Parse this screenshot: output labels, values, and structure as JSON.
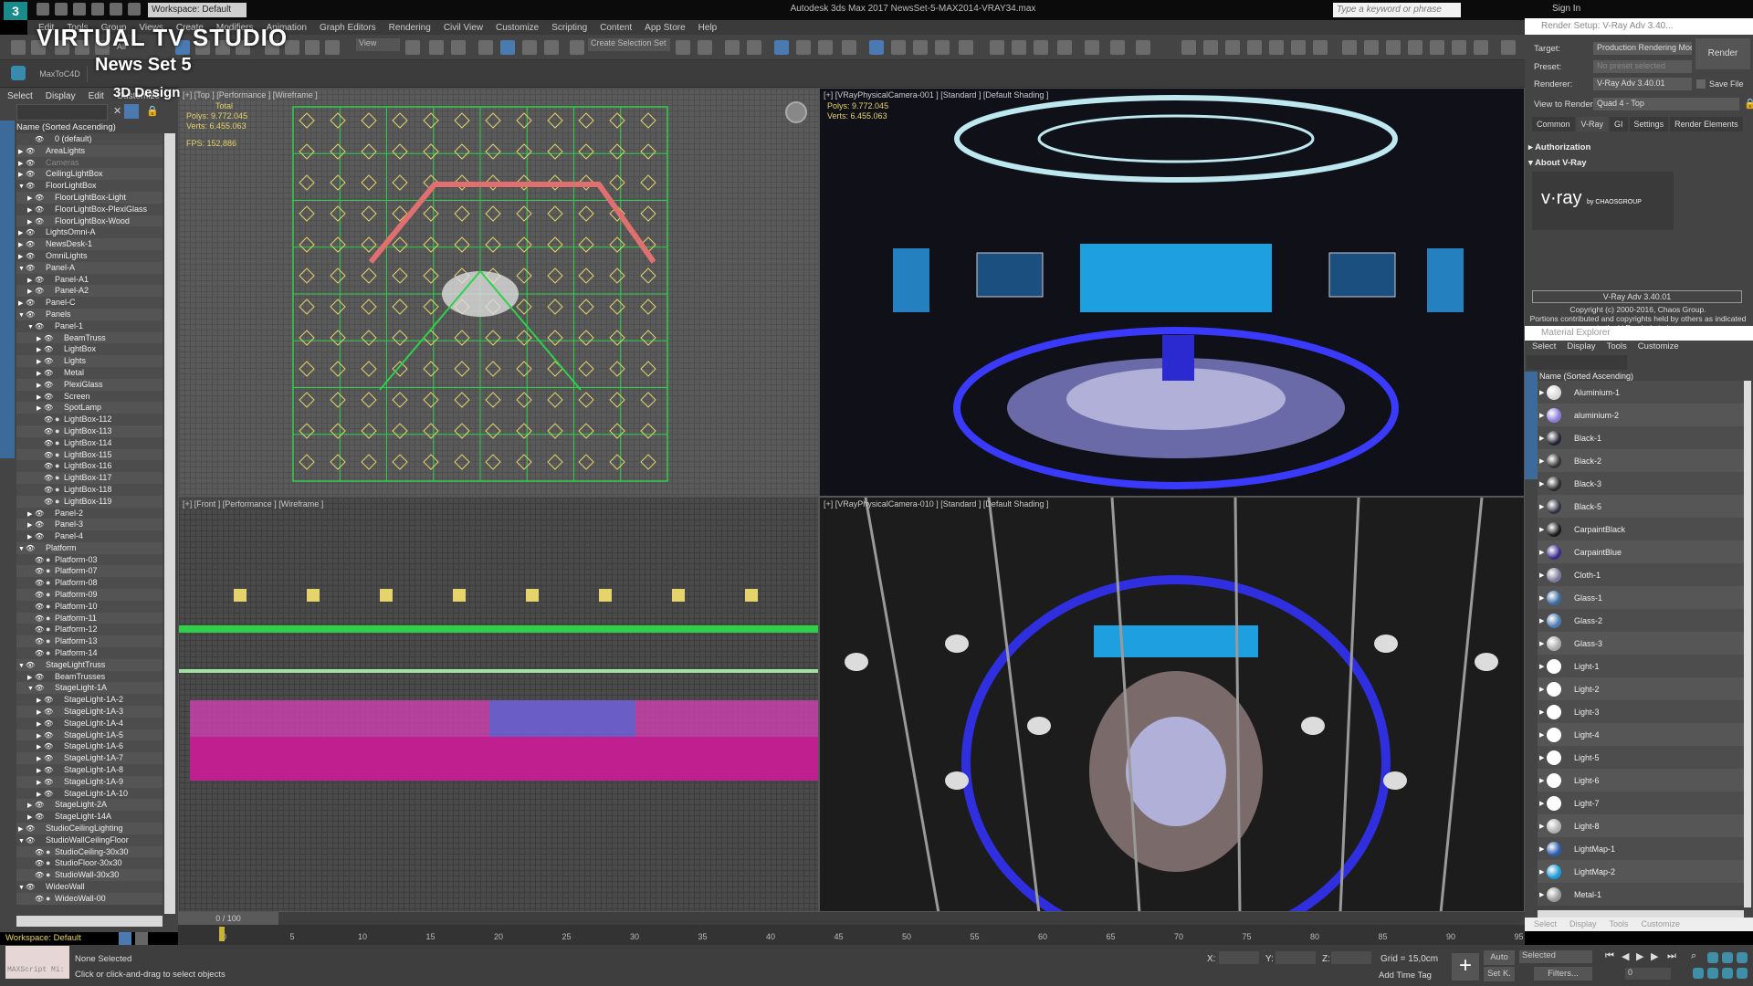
{
  "window": {
    "app_title": "Autodesk 3ds Max 2017     NewsSet-5-MAX2014-VRAY34.max",
    "workspace": "Workspace: Default",
    "search_placeholder": "Type a keyword or phrase",
    "sign_in": "Sign In"
  },
  "menu": [
    "Edit",
    "Tools",
    "Group",
    "Views",
    "Create",
    "Modifiers",
    "Animation",
    "Graph Editors",
    "Rendering",
    "Civil View",
    "Customize",
    "Scripting",
    "Content",
    "App Store",
    "Help"
  ],
  "toolbar": {
    "selection_filter": "All",
    "reference_coord": "View",
    "create_selection_set": "Create Selection Set"
  },
  "ribbon": {
    "plugin_label": "MaxToC4D"
  },
  "overlay": {
    "title": "VIRTUAL TV STUDIO",
    "subtitle": "News Set 5",
    "tag": "3D Design"
  },
  "scene_explorer": {
    "menu": [
      "Select",
      "Display",
      "Edit",
      "Customize"
    ],
    "header": "Name (Sorted Ascending)",
    "items": [
      {
        "name": "0 (default)",
        "depth": 1,
        "arrow": ""
      },
      {
        "name": "AreaLights",
        "depth": 0,
        "arrow": "▶"
      },
      {
        "name": "Cameras",
        "depth": 0,
        "arrow": "▶",
        "dim": true
      },
      {
        "name": "CeilingLightBox",
        "depth": 0,
        "arrow": "▶"
      },
      {
        "name": "FloorLightBox",
        "depth": 0,
        "arrow": "▼"
      },
      {
        "name": "FloorLightBox-Light",
        "depth": 1,
        "arrow": "▶"
      },
      {
        "name": "FloorLightBox-PlexiGlass",
        "depth": 1,
        "arrow": "▶"
      },
      {
        "name": "FloorLightBox-Wood",
        "depth": 1,
        "arrow": "▶"
      },
      {
        "name": "LightsOmni-A",
        "depth": 0,
        "arrow": "▶"
      },
      {
        "name": "NewsDesk-1",
        "depth": 0,
        "arrow": "▶"
      },
      {
        "name": "OmniLights",
        "depth": 0,
        "arrow": "▶"
      },
      {
        "name": "Panel-A",
        "depth": 0,
        "arrow": "▼"
      },
      {
        "name": "Panel-A1",
        "depth": 1,
        "arrow": "▶"
      },
      {
        "name": "Panel-A2",
        "depth": 1,
        "arrow": "▶"
      },
      {
        "name": "Panel-C",
        "depth": 0,
        "arrow": "▶"
      },
      {
        "name": "Panels",
        "depth": 0,
        "arrow": "▼"
      },
      {
        "name": "Panel-1",
        "depth": 1,
        "arrow": "▼"
      },
      {
        "name": "BeamTruss",
        "depth": 2,
        "arrow": "▶"
      },
      {
        "name": "LightBox",
        "depth": 2,
        "arrow": "▶"
      },
      {
        "name": "Lights",
        "depth": 2,
        "arrow": "▶"
      },
      {
        "name": "Metal",
        "depth": 2,
        "arrow": "▶"
      },
      {
        "name": "PlexiGlass",
        "depth": 2,
        "arrow": "▶"
      },
      {
        "name": "Screen",
        "depth": 2,
        "arrow": "▶"
      },
      {
        "name": "SpotLamp",
        "depth": 2,
        "arrow": "▶"
      },
      {
        "name": "LightBox-112",
        "depth": 2,
        "arrow": "",
        "obj": true
      },
      {
        "name": "LightBox-113",
        "depth": 2,
        "arrow": "",
        "obj": true
      },
      {
        "name": "LightBox-114",
        "depth": 2,
        "arrow": "",
        "obj": true
      },
      {
        "name": "LightBox-115",
        "depth": 2,
        "arrow": "",
        "obj": true
      },
      {
        "name": "LightBox-116",
        "depth": 2,
        "arrow": "",
        "obj": true
      },
      {
        "name": "LightBox-117",
        "depth": 2,
        "arrow": "",
        "obj": true
      },
      {
        "name": "LightBox-118",
        "depth": 2,
        "arrow": "",
        "obj": true
      },
      {
        "name": "LightBox-119",
        "depth": 2,
        "arrow": "",
        "obj": true
      },
      {
        "name": "Panel-2",
        "depth": 1,
        "arrow": "▶"
      },
      {
        "name": "Panel-3",
        "depth": 1,
        "arrow": "▶"
      },
      {
        "name": "Panel-4",
        "depth": 1,
        "arrow": "▶"
      },
      {
        "name": "Platform",
        "depth": 0,
        "arrow": "▼"
      },
      {
        "name": "Platform-03",
        "depth": 1,
        "arrow": "",
        "obj": true
      },
      {
        "name": "Platform-07",
        "depth": 1,
        "arrow": "",
        "obj": true
      },
      {
        "name": "Platform-08",
        "depth": 1,
        "arrow": "",
        "obj": true
      },
      {
        "name": "Platform-09",
        "depth": 1,
        "arrow": "",
        "obj": true
      },
      {
        "name": "Platform-10",
        "depth": 1,
        "arrow": "",
        "obj": true
      },
      {
        "name": "Platform-11",
        "depth": 1,
        "arrow": "",
        "obj": true
      },
      {
        "name": "Platform-12",
        "depth": 1,
        "arrow": "",
        "obj": true
      },
      {
        "name": "Platform-13",
        "depth": 1,
        "arrow": "",
        "obj": true
      },
      {
        "name": "Platform-14",
        "depth": 1,
        "arrow": "",
        "obj": true
      },
      {
        "name": "StageLightTruss",
        "depth": 0,
        "arrow": "▼"
      },
      {
        "name": "BeamTrusses",
        "depth": 1,
        "arrow": "▶"
      },
      {
        "name": "StageLight-1A",
        "depth": 1,
        "arrow": "▼"
      },
      {
        "name": "StageLight-1A-2",
        "depth": 2,
        "arrow": "▶"
      },
      {
        "name": "StageLight-1A-3",
        "depth": 2,
        "arrow": "▶"
      },
      {
        "name": "StageLight-1A-4",
        "depth": 2,
        "arrow": "▶"
      },
      {
        "name": "StageLight-1A-5",
        "depth": 2,
        "arrow": "▶"
      },
      {
        "name": "StageLight-1A-6",
        "depth": 2,
        "arrow": "▶"
      },
      {
        "name": "StageLight-1A-7",
        "depth": 2,
        "arrow": "▶"
      },
      {
        "name": "StageLight-1A-8",
        "depth": 2,
        "arrow": "▶"
      },
      {
        "name": "StageLight-1A-9",
        "depth": 2,
        "arrow": "▶"
      },
      {
        "name": "StageLight-1A-10",
        "depth": 2,
        "arrow": "▶"
      },
      {
        "name": "StageLight-2A",
        "depth": 1,
        "arrow": "▶"
      },
      {
        "name": "StageLight-14A",
        "depth": 1,
        "arrow": "▶"
      },
      {
        "name": "StudioCeilingLighting",
        "depth": 0,
        "arrow": "▶"
      },
      {
        "name": "StudioWallCeilingFloor",
        "depth": 0,
        "arrow": "▼"
      },
      {
        "name": "StudioCeiling-30x30",
        "depth": 1,
        "arrow": "",
        "obj": true
      },
      {
        "name": "StudioFloor-30x30",
        "depth": 1,
        "arrow": "",
        "obj": true
      },
      {
        "name": "StudioWall-30x30",
        "depth": 1,
        "arrow": "",
        "obj": true
      },
      {
        "name": "WideoWall",
        "depth": 0,
        "arrow": "▼"
      },
      {
        "name": "WideoWall-00",
        "depth": 1,
        "arrow": "",
        "obj": true
      }
    ]
  },
  "viewports": {
    "top": {
      "label": "[+] [Top ] [Performance ] [Wireframe ]",
      "stats_title": "Total",
      "polys_label": "Polys:",
      "polys": "9.772.045",
      "verts_label": "Verts:",
      "verts": "6.455.063",
      "fps_label": "FPS:",
      "fps": "152,886"
    },
    "cam1": {
      "label": "[+] [VRayPhysicalCamera-001 ] [Standard ] [Default Shading ]",
      "polys_label": "Polys:",
      "polys": "9.772.045",
      "verts_label": "Verts:",
      "verts": "6.455.063"
    },
    "front": {
      "label": "[+] [Front ] [Performance ] [Wireframe ]"
    },
    "cam2": {
      "label": "[+] [VRayPhysicalCamera-010 ] [Standard ] [Default Shading ]"
    }
  },
  "render_setup": {
    "title": "Render Setup: V-Ray Adv 3.40...",
    "target_label": "Target:",
    "target": "Production Rendering Mode",
    "preset_label": "Preset:",
    "preset": "No preset selected",
    "renderer_label": "Renderer:",
    "renderer": "V-Ray Adv 3.40.01",
    "save_file": "Save File",
    "view_label": "View to Render:",
    "view": "Quad 4 - Top",
    "render_button": "Render",
    "tabs": [
      "Common",
      "V-Ray",
      "GI",
      "Settings",
      "Render Elements"
    ],
    "active_tab": "V-Ray",
    "rollouts": [
      "Authorization",
      "About V-Ray"
    ],
    "logo": "v·ray",
    "logo_by": "by CHAOSGROUP",
    "version": "V-Ray Adv 3.40.01",
    "copyright": "Copyright (c) 2000-2016, Chaos Group.",
    "copyright2": "Portions contributed and copyrights held by others as indicated in the V-Ray help index."
  },
  "material_explorer": {
    "title": "Material Explorer",
    "menu": [
      "Select",
      "Display",
      "Tools",
      "Customize"
    ],
    "header": "Name (Sorted Ascending)",
    "items": [
      {
        "name": "Aluminium-1",
        "color": "#d8d8d8"
      },
      {
        "name": "aluminium-2",
        "color": "#8a7ad8"
      },
      {
        "name": "Black-1",
        "color": "#222233"
      },
      {
        "name": "Black-2",
        "color": "#333333"
      },
      {
        "name": "Black-3",
        "color": "#2a2a2a"
      },
      {
        "name": "Black-5",
        "color": "#303040"
      },
      {
        "name": "CarpaintBlack",
        "color": "#1a1a1a"
      },
      {
        "name": "CarpaintBlue",
        "color": "#3a2a8a"
      },
      {
        "name": "Cloth-1",
        "color": "#7a7a9a"
      },
      {
        "name": "Glass-1",
        "color": "#3a6aa0"
      },
      {
        "name": "Glass-2",
        "color": "#4a7ab0"
      },
      {
        "name": "Glass-3",
        "color": "#aaaaaa"
      },
      {
        "name": "Light-1",
        "color": "#ffffff"
      },
      {
        "name": "Light-2",
        "color": "#ffffff"
      },
      {
        "name": "Light-3",
        "color": "#ffffff"
      },
      {
        "name": "Light-4",
        "color": "#ffffff"
      },
      {
        "name": "Light-5",
        "color": "#ffffff"
      },
      {
        "name": "Light-6",
        "color": "#ffffff"
      },
      {
        "name": "Light-7",
        "color": "#ffffff"
      },
      {
        "name": "Light-8",
        "color": "#b0b0b0"
      },
      {
        "name": "LightMap-1",
        "color": "#2a5ab0"
      },
      {
        "name": "LightMap-2",
        "color": "#1a9ad8"
      },
      {
        "name": "Metal-1",
        "color": "#999999"
      }
    ],
    "bottom_menu": [
      "Select",
      "Display",
      "Tools",
      "Customize"
    ]
  },
  "timeline": {
    "slider": "0 / 100",
    "ticks": [
      "0",
      "5",
      "10",
      "15",
      "20",
      "25",
      "30",
      "35",
      "40",
      "45",
      "50",
      "55",
      "60",
      "65",
      "70",
      "75",
      "80",
      "85",
      "90",
      "95"
    ],
    "current_frame": "0"
  },
  "status": {
    "workspace": "Workspace: Default",
    "maxscript": "MAXScript Mi:",
    "selection": "None Selected",
    "hint": "Click or click-and-drag to select objects",
    "x_label": "X:",
    "y_label": "Y:",
    "z_label": "Z:",
    "grid": "Grid = 15,0cm",
    "add_time_tag": "Add Time Tag",
    "auto": "Auto",
    "set_key": "Set K.",
    "key_filter": "Selected",
    "filters": "Filters...",
    "frame": "0"
  }
}
